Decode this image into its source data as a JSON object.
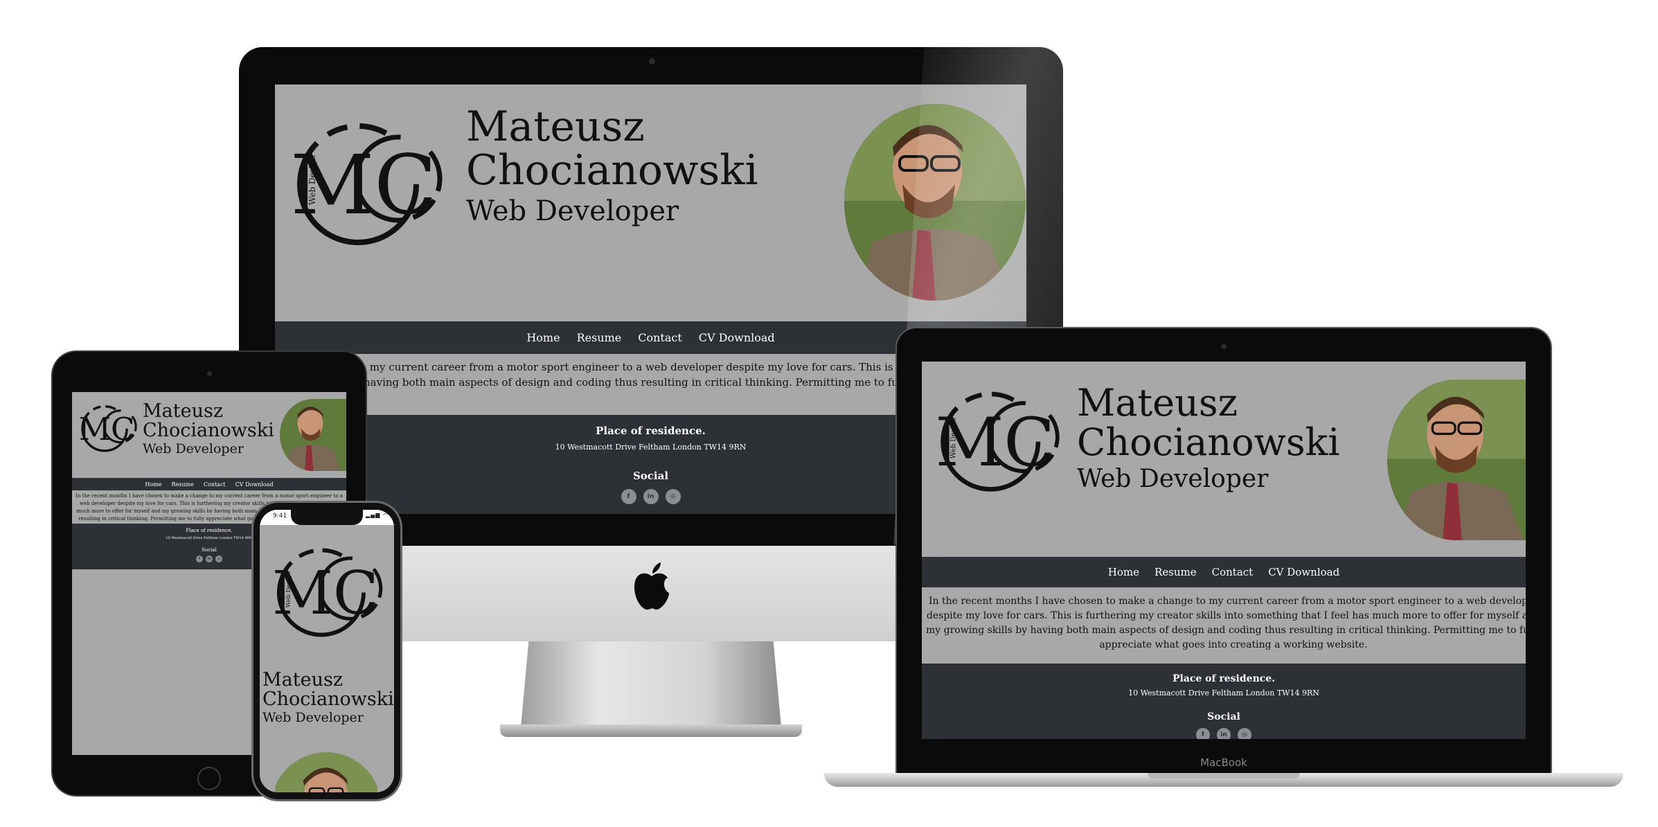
{
  "site": {
    "logo_initials": "MC",
    "logo_tag": "Web Design",
    "first_name": "Mateusz",
    "last_name": "Chocianowski",
    "role": "Web Developer",
    "nav": [
      "Home",
      "Resume",
      "Contact",
      "CV Download"
    ],
    "intro": "In the recent months I have chosen to make a change to my current career from a motor sport engineer to a web developer despite my love for cars. This is furthering my creator skills into something that I feel has much more to offer for myself and my growing skills by having both main aspects of design and coding thus resulting in critical thinking. Permitting me to fully appreciate what goes into creating a working website.",
    "residence_heading": "Place of residence.",
    "address": "10 Westmacott Drive Feltham London TW14 9RN",
    "social_heading": "Social",
    "social_icons": [
      "facebook-icon",
      "linkedin-icon",
      "instagram-icon"
    ],
    "social_glyphs": [
      "f",
      "in",
      "◎"
    ]
  },
  "devices": {
    "laptop_brand": "MacBook",
    "phone_time": "9:41",
    "phone_status": "▂▄▆ ◠ ▭"
  },
  "colors": {
    "page_bg": "#a8a8a8",
    "nav_bg": "#2d3035",
    "footer_bg": "#2d3035",
    "text_dark": "#111111",
    "text_light": "#ffffff"
  }
}
